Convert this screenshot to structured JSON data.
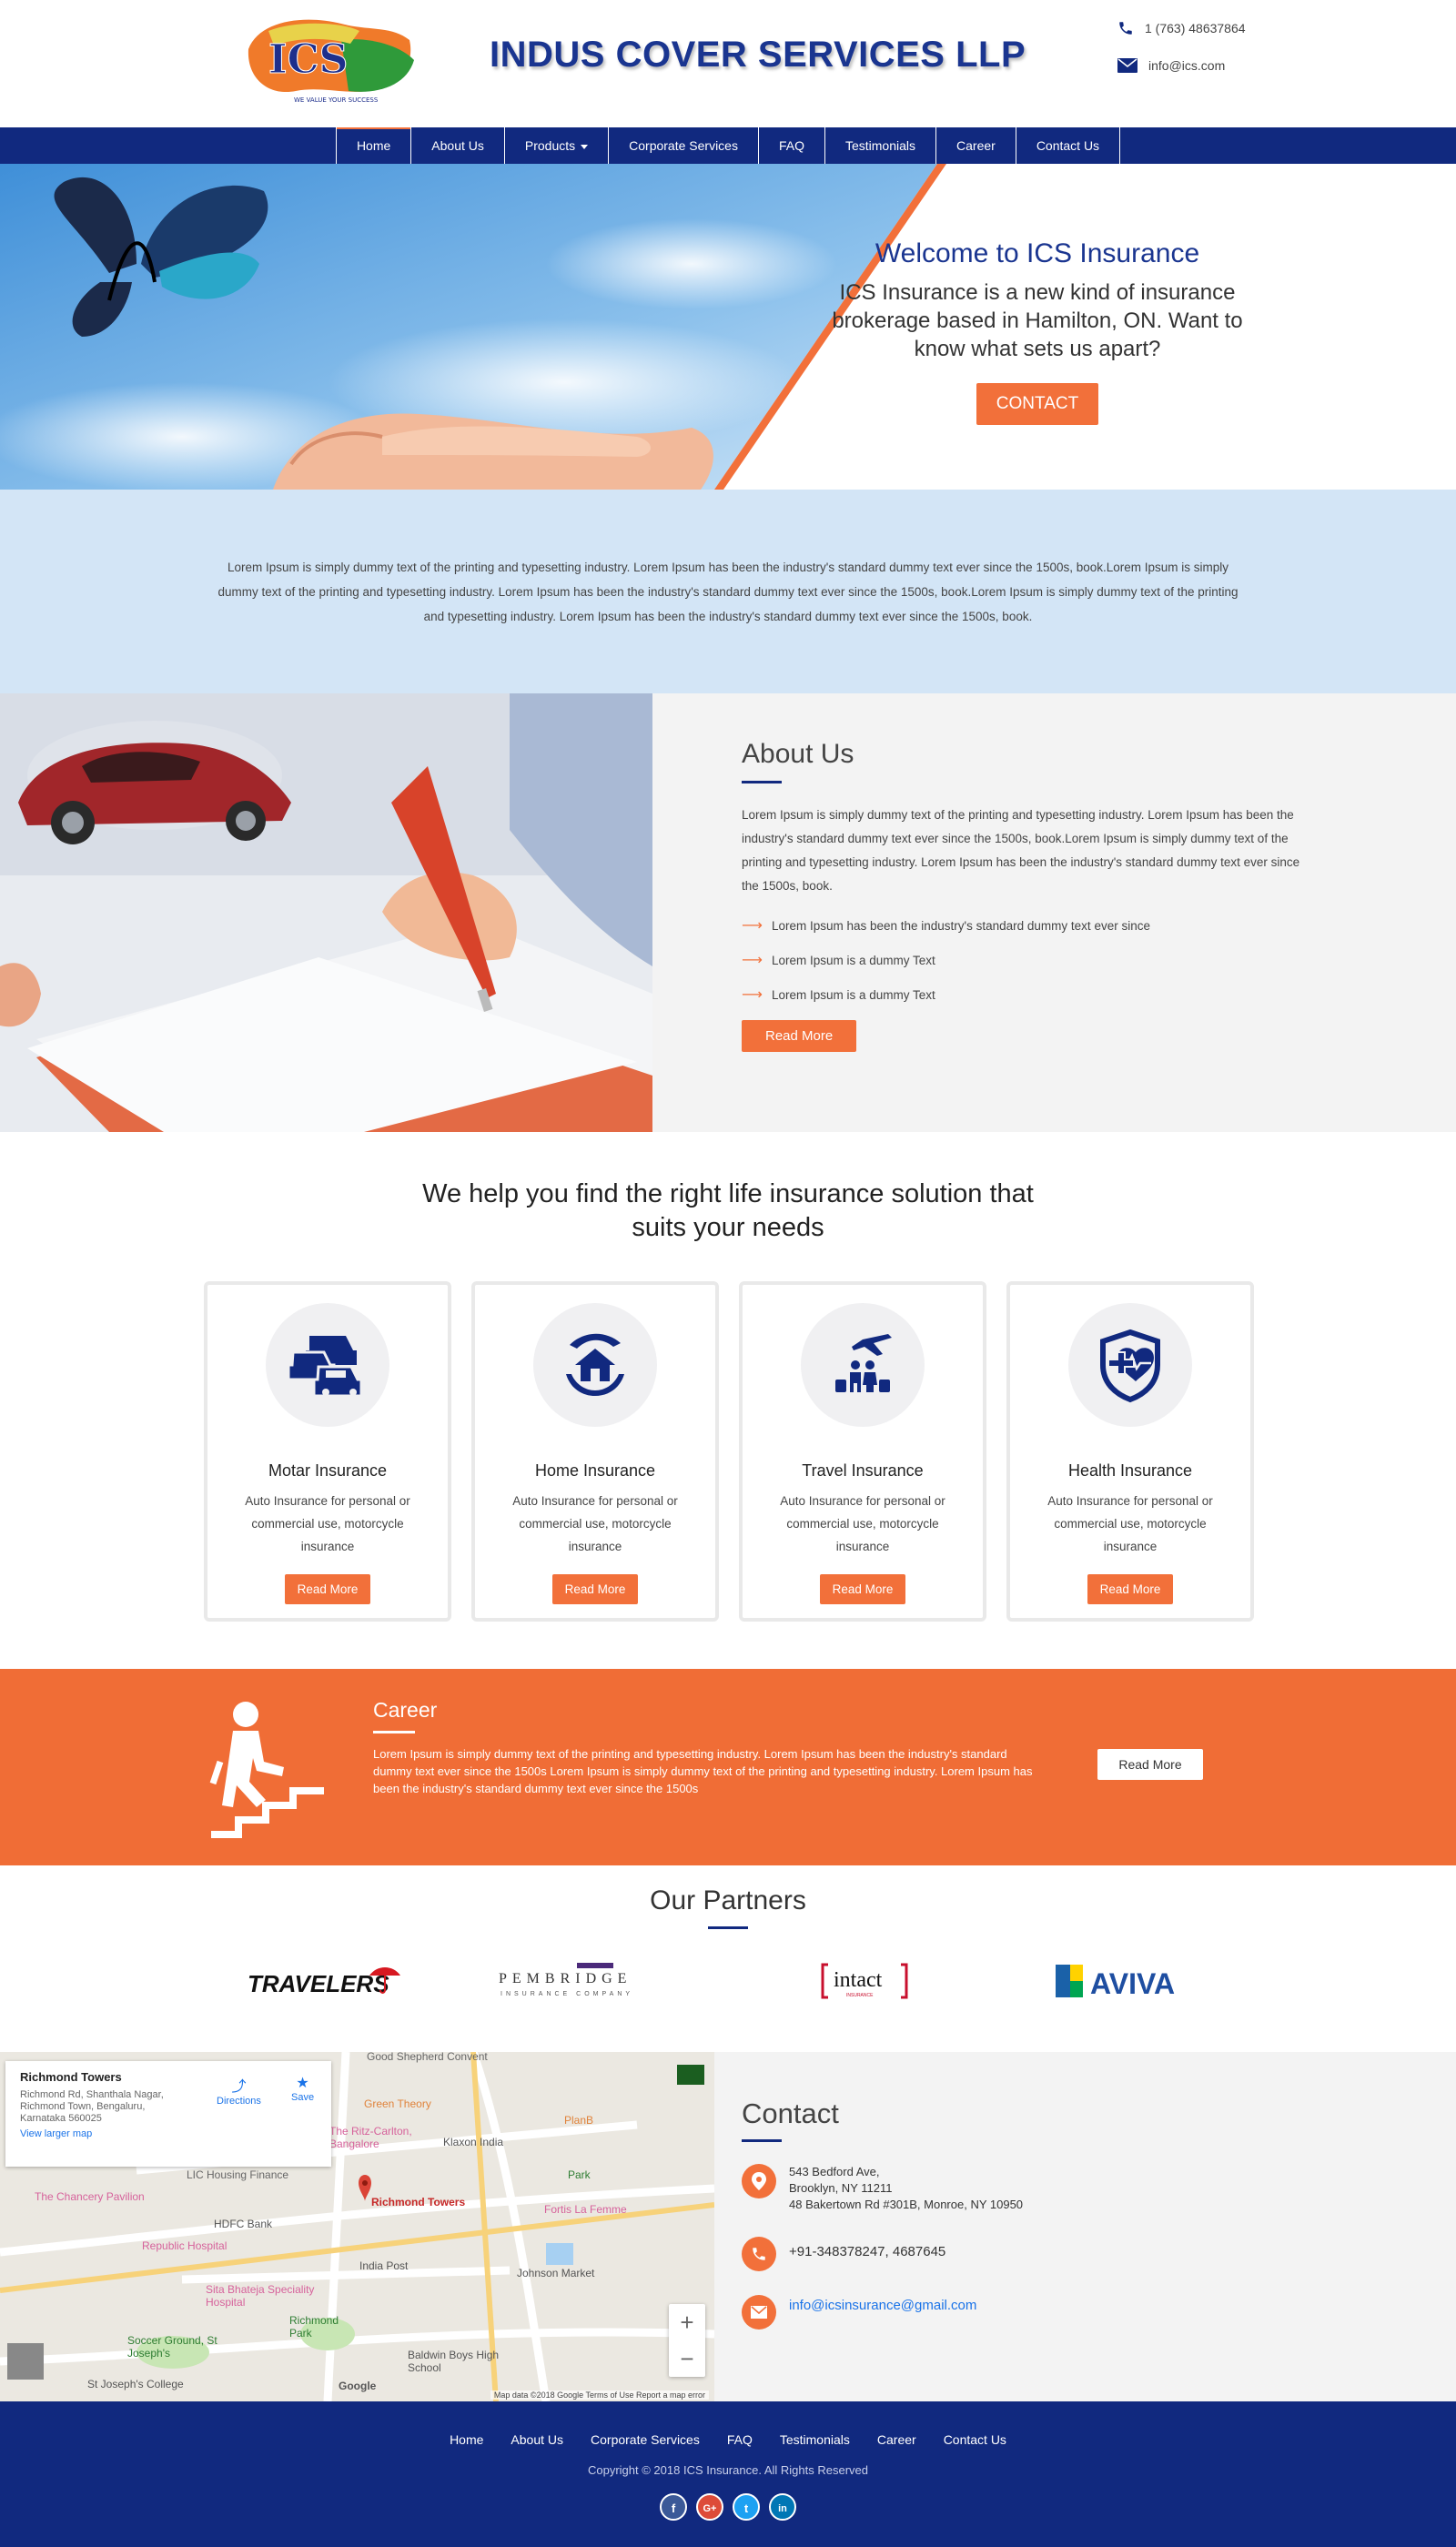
{
  "header": {
    "logo_text": "ICS",
    "logo_tagline": "WE VALUE YOUR SUCCESS",
    "company": "INDUS COVER SERVICES LLP",
    "phone": "1 (763) 48637864",
    "email": "info@ics.com"
  },
  "nav": {
    "items": [
      {
        "label": "Home"
      },
      {
        "label": "About Us"
      },
      {
        "label": "Products"
      },
      {
        "label": "Corporate Services"
      },
      {
        "label": "FAQ"
      },
      {
        "label": "Testimonials"
      },
      {
        "label": "Career"
      },
      {
        "label": "Contact Us"
      }
    ]
  },
  "hero": {
    "title": "Welcome to ICS Insurance",
    "subtitle": "ICS Insurance is a new kind of insurance brokerage based in Hamilton, ON. Want to know what sets us apart?",
    "button": "CONTACT"
  },
  "intro": {
    "text": "Lorem Ipsum is simply dummy text of the printing and typesetting industry. Lorem Ipsum has been the industry's standard dummy text ever since the 1500s, book.Lorem Ipsum is simply dummy text of the printing and typesetting industry. Lorem Ipsum has been the industry's standard dummy text ever since the 1500s, book.Lorem Ipsum is simply dummy text of the printing and typesetting industry. Lorem Ipsum has been the industry's standard dummy text ever since the 1500s, book."
  },
  "about": {
    "title": "About Us",
    "paragraph": "Lorem Ipsum is simply dummy text of the printing and typesetting industry. Lorem Ipsum has been the industry's standard dummy text ever since the 1500s, book.Lorem Ipsum is simply dummy text of the printing and typesetting industry. Lorem Ipsum has been the industry's standard dummy text ever since the 1500s, book.",
    "list": [
      "Lorem Ipsum has been the industry's standard dummy text ever since",
      "Lorem Ipsum is a dummy Text",
      "Lorem Ipsum is a dummy Text"
    ],
    "button": "Read More"
  },
  "solutions": {
    "heading_line1": "We help you find the right life insurance solution that",
    "heading_line2": "suits your needs",
    "cards": [
      {
        "title": "Motar Insurance",
        "desc": "Auto Insurance for personal or commercial use, motorcycle insurance",
        "button": "Read More",
        "icon": "cars-icon"
      },
      {
        "title": "Home Insurance",
        "desc": "Auto Insurance for personal or commercial use, motorcycle insurance",
        "button": "Read More",
        "icon": "home-hands-icon"
      },
      {
        "title": "Travel Insurance",
        "desc": "Auto Insurance for personal or commercial use, motorcycle insurance",
        "button": "Read More",
        "icon": "travel-icon"
      },
      {
        "title": "Health Insurance",
        "desc": "Auto Insurance for personal or commercial use, motorcycle insurance",
        "button": "Read More",
        "icon": "health-shield-icon"
      }
    ]
  },
  "career": {
    "title": "Career",
    "text": "Lorem Ipsum is simply dummy text of the printing and typesetting industry. Lorem Ipsum has been the industry's standard dummy text ever since the 1500s Lorem Ipsum is simply dummy text of the printing and typesetting industry. Lorem Ipsum has been the industry's standard dummy text ever since the 1500s",
    "button": "Read More"
  },
  "partners": {
    "title": "Our Partners",
    "logos": [
      "TRAVELERS",
      "PEMBRIDGE",
      "INSURANCE COMPANY",
      "intact",
      "INSURANCE",
      "AVIVA"
    ]
  },
  "map": {
    "place_name": "Richmond Towers",
    "place_address": "Richmond Rd, Shanthala Nagar, Richmond Town, Bengaluru, Karnataka 560025",
    "directions": "Directions",
    "save": "Save",
    "larger_map": "View larger map",
    "labels": {
      "shepherd": "Good Shepherd Convent",
      "green": "Green Theory",
      "ritz": "The Ritz-Carlton, Bangalore",
      "planb": "PlanB",
      "klaxon": "Klaxon India",
      "lic": "LIC Housing Finance",
      "chancery": "The Chancery Pavilion",
      "park": "Park",
      "towers": "Richmond Towers",
      "fortis": "Fortis La Femme",
      "hdfc": "HDFC Bank",
      "republic": "Republic Hospital",
      "indiapost": "India Post",
      "johnson": "Johnson Market",
      "sita": "Sita Bhateja Speciality Hospital",
      "richpark": "Richmond Park",
      "soccer": "Soccer Ground, St Joseph's",
      "baldwin": "Baldwin Boys High School",
      "stjoseph": "St Joseph's College",
      "google": "Google"
    },
    "zoom_in": "+",
    "zoom_out": "−",
    "attribution": "Map data ©2018 Google    Terms of Use    Report a map error"
  },
  "contact": {
    "title": "Contact",
    "address_line1": "543 Bedford Ave,",
    "address_line2": "Brooklyn, NY 11211",
    "address_line3": "48 Bakertown Rd #301B, Monroe, NY 10950",
    "phone": "+91-348378247, 4687645",
    "email": "info@icsinsurance@gmail.com"
  },
  "footer": {
    "nav": [
      {
        "label": "Home"
      },
      {
        "label": "About Us"
      },
      {
        "label": "Corporate Services"
      },
      {
        "label": "FAQ"
      },
      {
        "label": "Testimonials"
      },
      {
        "label": "Career"
      },
      {
        "label": "Contact Us"
      }
    ],
    "copyright": "Copyright © 2018 ICS Insurance. All Rights Reserved",
    "socials": [
      {
        "glyph": "f",
        "icon": "facebook-icon",
        "color": "#3b5998"
      },
      {
        "glyph": "G+",
        "icon": "google-plus-icon",
        "color": "#dd4b39"
      },
      {
        "glyph": "t",
        "icon": "twitter-icon",
        "color": "#1da1f2"
      },
      {
        "glyph": "in",
        "icon": "linkedin-icon",
        "color": "#0077b5"
      }
    ]
  },
  "colors": {
    "brand_blue": "#11297f",
    "accent_orange": "#f2703a",
    "intro_bg": "#d3e5f6"
  }
}
